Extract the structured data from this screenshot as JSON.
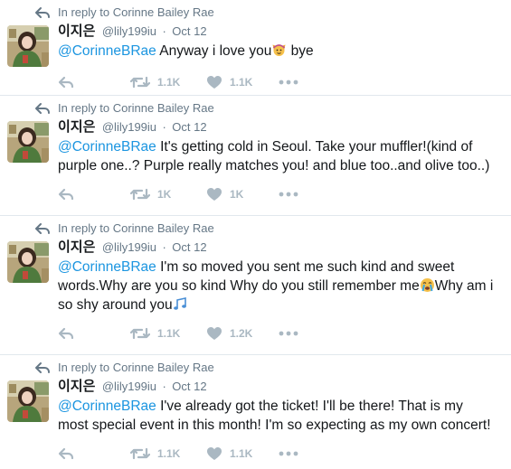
{
  "reply_context_prefix": "In reply to",
  "tweets": [
    {
      "reply_to": "Corinne Bailey Rae",
      "name": "이지은",
      "handle": "@lily199iu",
      "sep": "·",
      "time": "Oct 12",
      "mention": "@CorinneBRae",
      "text_a": " Anyway i love you",
      "emoji_a": "person-raising-hands-emoji",
      "text_b": " bye",
      "retweets": "1.1K",
      "likes": "1.1K"
    },
    {
      "reply_to": "Corinne Bailey Rae",
      "name": "이지은",
      "handle": "@lily199iu",
      "sep": "·",
      "time": "Oct 12",
      "mention": "@CorinneBRae",
      "text_a": " It's getting cold in Seoul. Take your muffler!(kind of purple one..? Purple really matches you! and blue too..and olive too..)",
      "retweets": "1K",
      "likes": "1K"
    },
    {
      "reply_to": "Corinne Bailey Rae",
      "name": "이지은",
      "handle": "@lily199iu",
      "sep": "·",
      "time": "Oct 12",
      "mention": "@CorinneBRae",
      "text_a": " I'm so moved you sent me such kind and sweet words.Why are you so kind Why do you still remember me",
      "emoji_a": "loudly-crying-face-emoji",
      "text_b": "Why am i so shy around you",
      "emoji_b": "musical-notes-emoji",
      "retweets": "1.1K",
      "likes": "1.2K"
    },
    {
      "reply_to": "Corinne Bailey Rae",
      "name": "이지은",
      "handle": "@lily199iu",
      "sep": "·",
      "time": "Oct 12",
      "mention": "@CorinneBRae",
      "text_a": " I've already got the ticket! I'll be there! That is my most special event in this month! I'm so expecting as my own concert!",
      "retweets": "1.1K",
      "likes": "1.1K"
    }
  ],
  "colors": {
    "mention": "#1b95e0",
    "meta": "#657786",
    "action": "#aab8c2",
    "divider": "#e1e8ed"
  }
}
